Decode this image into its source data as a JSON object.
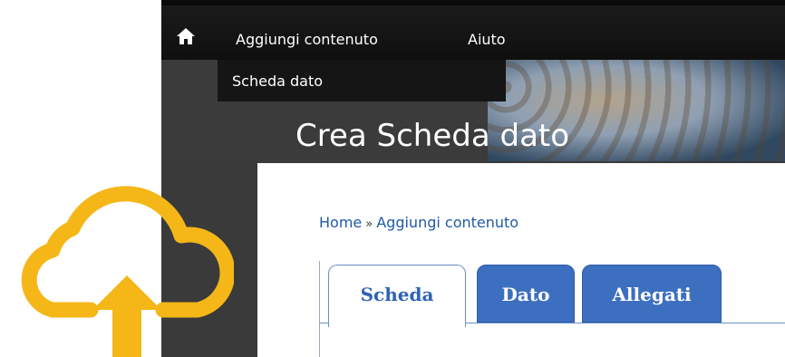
{
  "toolbar": {
    "home_icon": "home-icon",
    "links": [
      "Aggiungi contenuto",
      "Aiuto"
    ]
  },
  "secondary": {
    "active_item": "Scheda dato"
  },
  "page": {
    "title": "Crea Scheda dato"
  },
  "breadcrumb": {
    "items": [
      "Home",
      "Aggiungi contenuto"
    ],
    "separator": "»"
  },
  "tabs": [
    {
      "label": "Scheda",
      "active": true
    },
    {
      "label": "Dato",
      "active": false
    },
    {
      "label": "Allegati",
      "active": false
    }
  ],
  "overlay": {
    "icon": "cloud-upload-icon",
    "color": "#f5b718"
  },
  "colors": {
    "toolbar_bg": "#111111",
    "link_blue": "#1f5aa6",
    "tab_blue": "#3d6fc0"
  }
}
